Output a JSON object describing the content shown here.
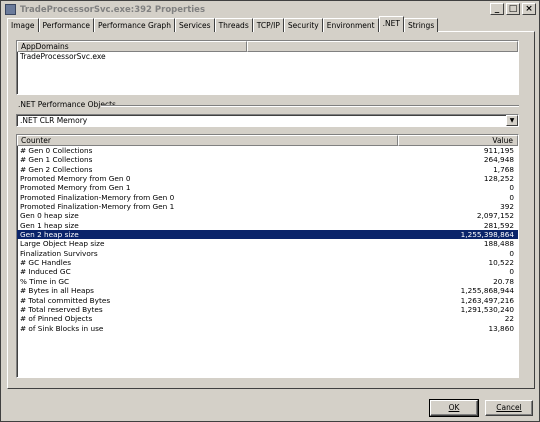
{
  "window": {
    "title": "TradeProcessorSvc.exe:392 Properties",
    "controls": {
      "minimize": "_",
      "maximize": "□",
      "close": "×"
    }
  },
  "tabs": [
    {
      "label": "Image"
    },
    {
      "label": "Performance"
    },
    {
      "label": "Performance Graph"
    },
    {
      "label": "Services"
    },
    {
      "label": "Threads"
    },
    {
      "label": "TCP/IP"
    },
    {
      "label": "Security"
    },
    {
      "label": "Environment"
    },
    {
      "label": ".NET",
      "active": true
    },
    {
      "label": "Strings"
    }
  ],
  "appdomains": {
    "header": "AppDomains",
    "items": [
      "TradeProcessorSvc.exe"
    ]
  },
  "perf_objects": {
    "label": ".NET Performance Objects",
    "selected": ".NET CLR Memory"
  },
  "counters": {
    "header_counter": "Counter",
    "header_value": "Value",
    "rows": [
      {
        "name": "# Gen 0 Collections",
        "value": "911,195"
      },
      {
        "name": "# Gen 1 Collections",
        "value": "264,948"
      },
      {
        "name": "# Gen 2 Collections",
        "value": "1,768"
      },
      {
        "name": "Promoted Memory from Gen 0",
        "value": "128,252"
      },
      {
        "name": "Promoted Memory from Gen 1",
        "value": "0"
      },
      {
        "name": "Promoted Finalization-Memory from Gen 0",
        "value": "0"
      },
      {
        "name": "Promoted Finalization-Memory from Gen 1",
        "value": "392"
      },
      {
        "name": "Gen 0 heap size",
        "value": "2,097,152"
      },
      {
        "name": "Gen 1 heap size",
        "value": "281,592"
      },
      {
        "name": "Gen 2 heap size",
        "value": "1,255,398,864",
        "selected": true
      },
      {
        "name": "Large Object Heap size",
        "value": "188,488"
      },
      {
        "name": "Finalization Survivors",
        "value": "0"
      },
      {
        "name": "# GC Handles",
        "value": "10,522"
      },
      {
        "name": "# Induced GC",
        "value": "0"
      },
      {
        "name": "% Time in GC",
        "value": "20.78"
      },
      {
        "name": "# Bytes in all Heaps",
        "value": "1,255,868,944"
      },
      {
        "name": "# Total committed Bytes",
        "value": "1,263,497,216"
      },
      {
        "name": "# Total reserved Bytes",
        "value": "1,291,530,240"
      },
      {
        "name": "# of Pinned Objects",
        "value": "22"
      },
      {
        "name": "# of Sink Blocks in use",
        "value": "13,860"
      }
    ]
  },
  "buttons": {
    "ok": "OK",
    "cancel": "Cancel"
  },
  "colors": {
    "face": "#d4d0c8",
    "selection": "#0a246a"
  }
}
